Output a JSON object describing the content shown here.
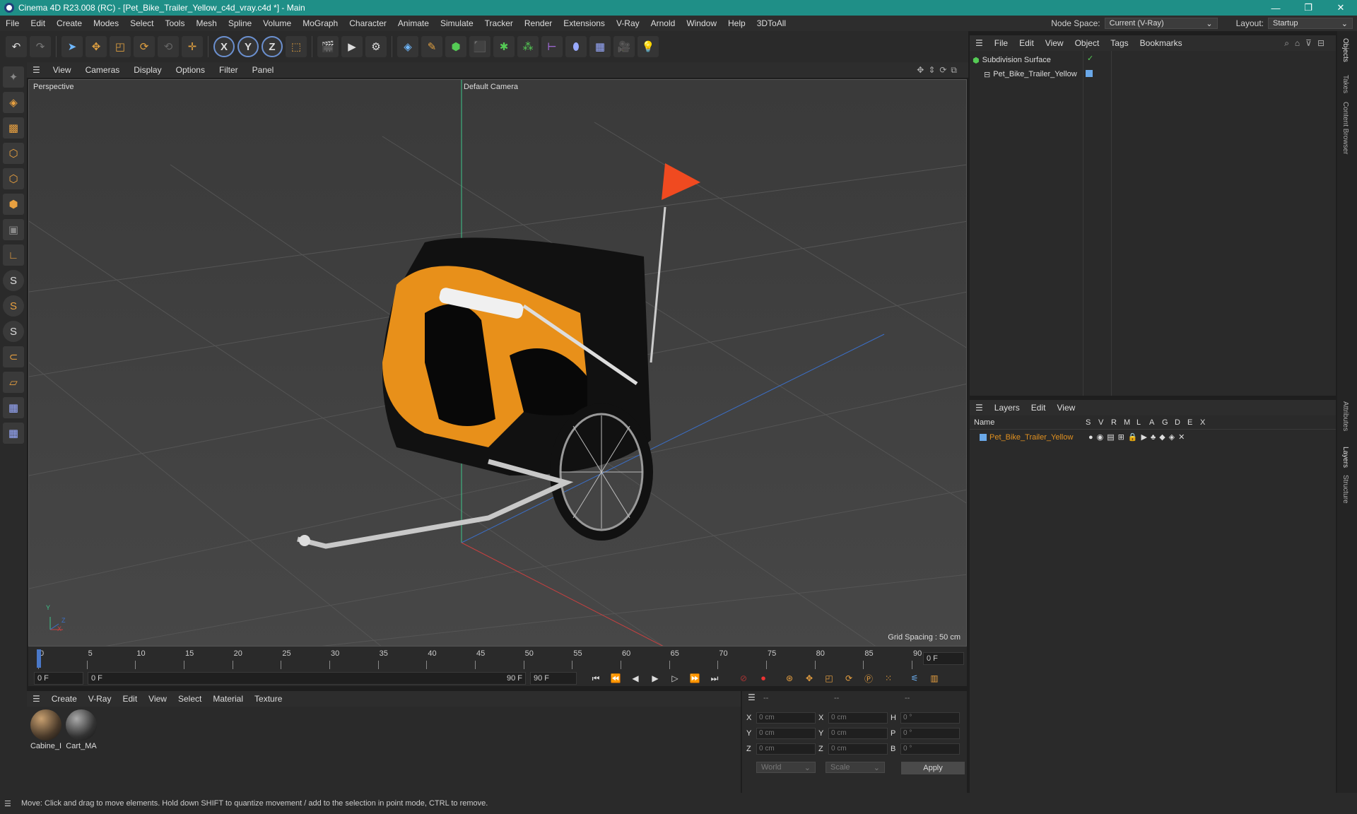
{
  "window": {
    "title": "Cinema 4D R23.008 (RC) - [Pet_Bike_Trailer_Yellow_c4d_vray.c4d *] - Main"
  },
  "menubar": {
    "items": [
      "File",
      "Edit",
      "Create",
      "Modes",
      "Select",
      "Tools",
      "Mesh",
      "Spline",
      "Volume",
      "MoGraph",
      "Character",
      "Animate",
      "Simulate",
      "Tracker",
      "Render",
      "Extensions",
      "V-Ray",
      "Arnold",
      "Window",
      "Help",
      "3DToAll"
    ],
    "node_space_label": "Node Space:",
    "node_space_value": "Current (V-Ray)",
    "layout_label": "Layout:",
    "layout_value": "Startup"
  },
  "toolbar": {
    "axis_x": "X",
    "axis_y": "Y",
    "axis_z": "Z"
  },
  "lefttools": {
    "s1": "S",
    "s2": "S",
    "s3": "S"
  },
  "viewport_menu": {
    "items": [
      "View",
      "Cameras",
      "Display",
      "Options",
      "Filter",
      "Panel"
    ]
  },
  "viewport": {
    "label": "Perspective",
    "camera": "Default Camera",
    "grid_spacing": "Grid Spacing : 50 cm",
    "axis_y": "Y",
    "axis_z": "Z",
    "axis_x": "X"
  },
  "timeline": {
    "ticks": [
      "0",
      "5",
      "10",
      "15",
      "20",
      "25",
      "30",
      "35",
      "40",
      "45",
      "50",
      "55",
      "60",
      "65",
      "70",
      "75",
      "80",
      "85",
      "90"
    ],
    "current_frame": "0 F"
  },
  "transport": {
    "start": "0 F",
    "range_start": "0 F",
    "range_end": "90 F",
    "end": "90 F"
  },
  "material_menu": {
    "items": [
      "Create",
      "V-Ray",
      "Edit",
      "View",
      "Select",
      "Material",
      "Texture"
    ]
  },
  "materials": [
    {
      "name": "Cabine_I"
    },
    {
      "name": "Cart_MA"
    }
  ],
  "coords": {
    "headers": [
      "--",
      "--",
      "--"
    ],
    "rows": [
      {
        "l1": "X",
        "v1": "0 cm",
        "l2": "X",
        "v2": "0 cm",
        "l3": "H",
        "v3": "0 °"
      },
      {
        "l1": "Y",
        "v1": "0 cm",
        "l2": "Y",
        "v2": "0 cm",
        "l3": "P",
        "v3": "0 °"
      },
      {
        "l1": "Z",
        "v1": "0 cm",
        "l2": "Z",
        "v2": "0 cm",
        "l3": "B",
        "v3": "0 °"
      }
    ],
    "space": "World",
    "mode": "Scale",
    "apply": "Apply"
  },
  "objects_menu": {
    "items": [
      "File",
      "Edit",
      "View",
      "Object",
      "Tags",
      "Bookmarks"
    ]
  },
  "objects": [
    {
      "name": "Subdivision Surface"
    },
    {
      "name": "Pet_Bike_Trailer_Yellow"
    }
  ],
  "layers_menu": {
    "items": [
      "Layers",
      "Edit",
      "View"
    ]
  },
  "layers_header": {
    "name": "Name",
    "cols": [
      "S",
      "V",
      "R",
      "M",
      "L",
      "A",
      "G",
      "D",
      "E",
      "X"
    ]
  },
  "layers": [
    {
      "name": "Pet_Bike_Trailer_Yellow",
      "color": "#e09020"
    }
  ],
  "right_tabs": [
    "Objects",
    "Takes",
    "Content Browser",
    "Attributes",
    "Layers",
    "Structure"
  ],
  "status": "Move: Click and drag to move elements. Hold down SHIFT to quantize movement / add to the selection in point mode, CTRL to remove."
}
